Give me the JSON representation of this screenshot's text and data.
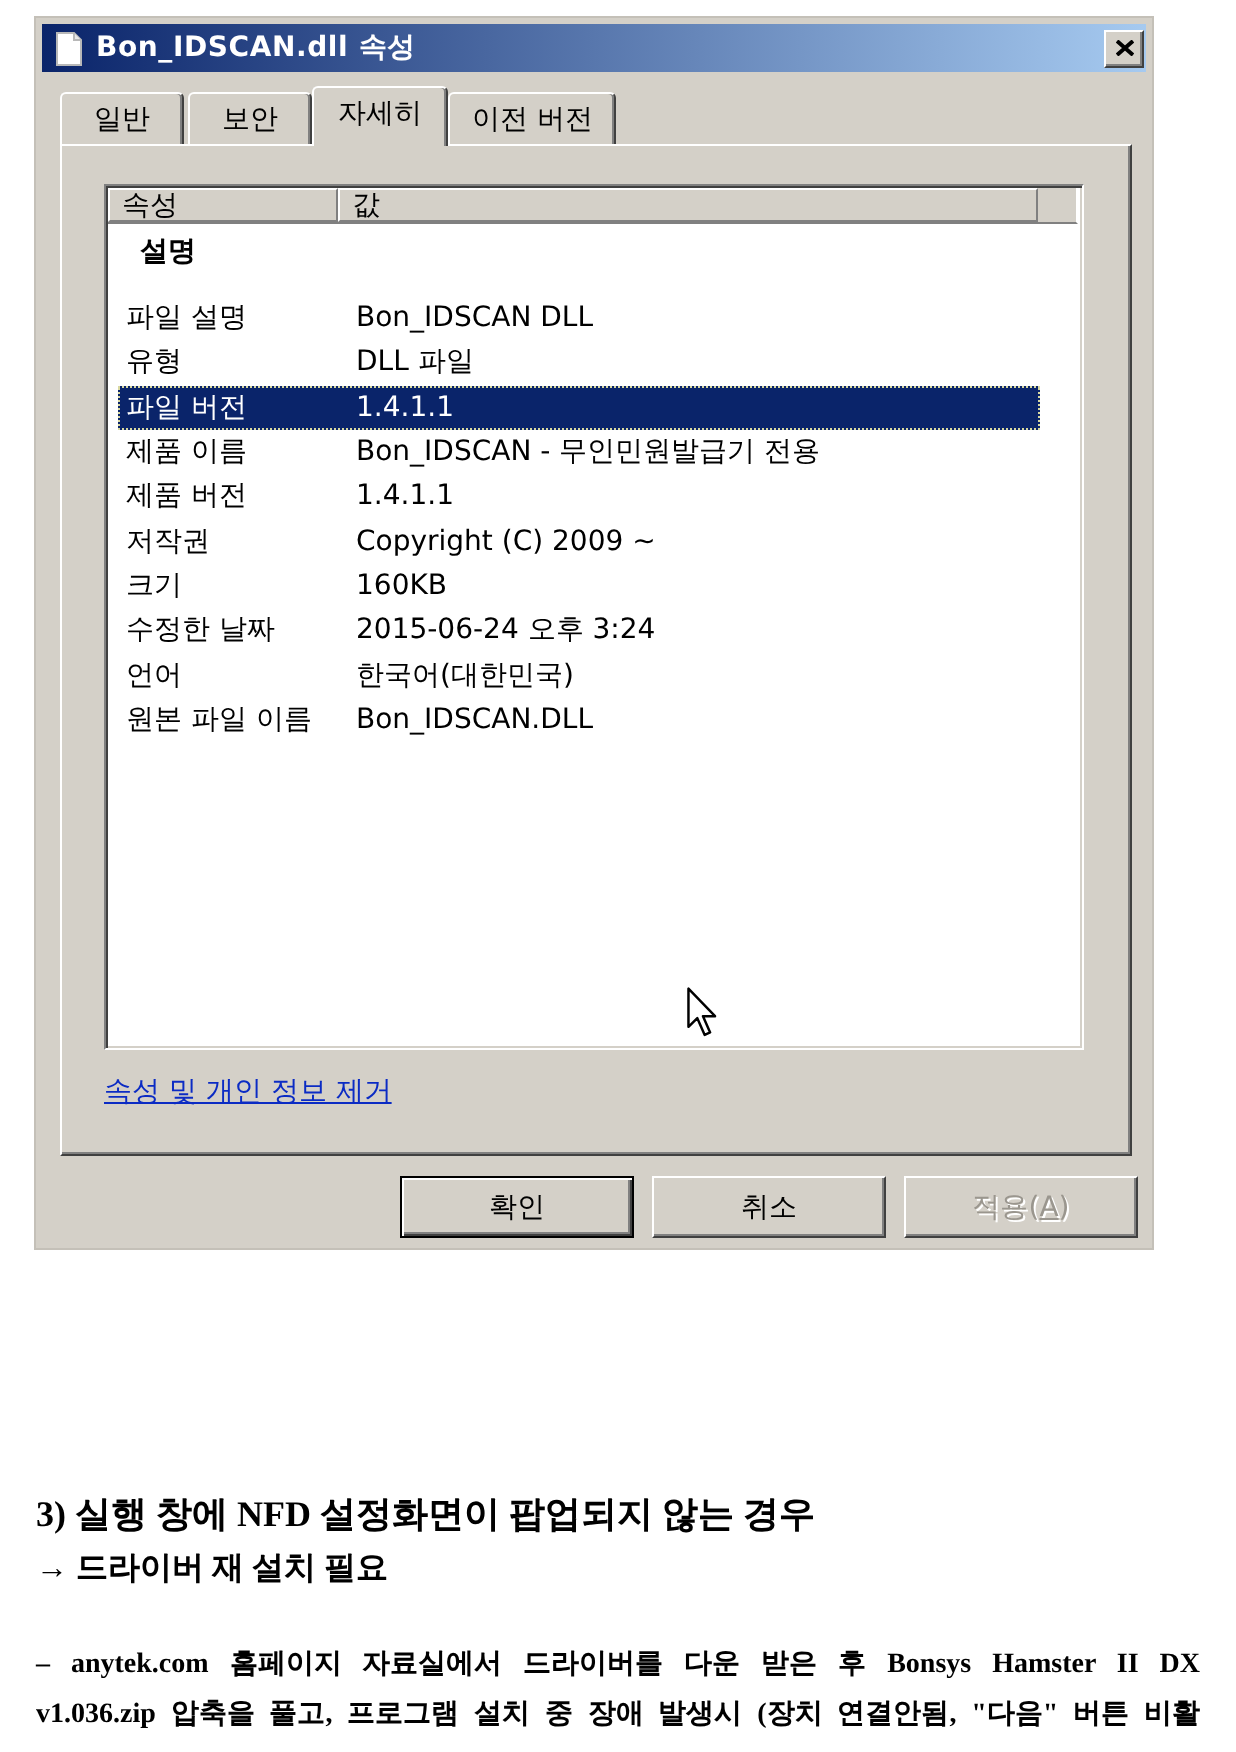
{
  "window": {
    "title": "Bon_IDSCAN.dll 속성"
  },
  "tabs": [
    {
      "label": "일반",
      "selected": false
    },
    {
      "label": "보안",
      "selected": false
    },
    {
      "label": "자세히",
      "selected": true
    },
    {
      "label": "이전 버전",
      "selected": false
    }
  ],
  "details": {
    "columns": [
      "속성",
      "값"
    ],
    "groups": [
      {
        "title": "설명",
        "rows": [
          {
            "property": "파일 설명",
            "value": "Bon_IDSCAN DLL",
            "selected": false
          },
          {
            "property": "유형",
            "value": "DLL 파일",
            "selected": false
          },
          {
            "property": "파일 버전",
            "value": "1.4.1.1",
            "selected": true
          },
          {
            "property": "제품 이름",
            "value": "Bon_IDSCAN - 무인민원발급기 전용",
            "selected": false
          },
          {
            "property": "제품 버전",
            "value": "1.4.1.1",
            "selected": false
          },
          {
            "property": "저작권",
            "value": "Copyright (C) 2009 ~",
            "selected": false
          },
          {
            "property": "크기",
            "value": "160KB",
            "selected": false
          },
          {
            "property": "수정한 날짜",
            "value": "2015-06-24 오후 3:24",
            "selected": false
          },
          {
            "property": "언어",
            "value": "한국어(대한민국)",
            "selected": false
          },
          {
            "property": "원본 파일 이름",
            "value": "Bon_IDSCAN.DLL",
            "selected": false
          }
        ]
      }
    ]
  },
  "link": {
    "label": "속성 및 개인 정보 제거"
  },
  "buttons": [
    {
      "label": "확인",
      "default": true,
      "disabled": false
    },
    {
      "label": "취소",
      "default": false,
      "disabled": false
    },
    {
      "label": "적용(",
      "access_key": "A",
      "label_end": ")",
      "default": false,
      "disabled": true
    }
  ],
  "article": {
    "heading": "3) 실행 창에 NFD 설정화면이 팝업되지 않는 경우",
    "subheading": "→ 드라이버 재 설치 필요",
    "paragraph_lines": [
      "– anytek.com 홈페이지 자료실에서 드라이버를 다운 받은 후 Bonsys Hamster II DX",
      "v1.036.zip 압축을 풀고, 프로그램 설치 중 장애 발생시 (장치 연결안됨, \"다음\" 버튼 비활"
    ]
  }
}
